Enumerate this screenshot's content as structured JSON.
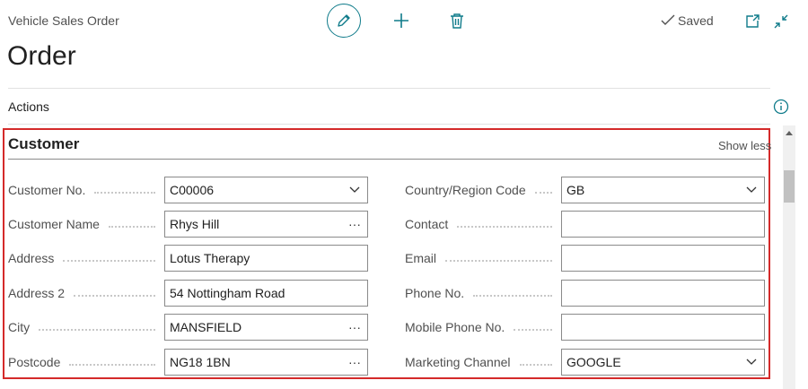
{
  "header": {
    "page_type": "Vehicle Sales Order",
    "title": "Order",
    "saved_label": "Saved"
  },
  "actions_label": "Actions",
  "section": {
    "title": "Customer",
    "show_less": "Show less"
  },
  "left_fields": [
    {
      "label": "Customer No.",
      "value": "C00006",
      "control": "dropdown"
    },
    {
      "label": "Customer Name",
      "value": "Rhys Hill",
      "control": "lookup"
    },
    {
      "label": "Address",
      "value": "Lotus Therapy",
      "control": "text"
    },
    {
      "label": "Address 2",
      "value": "54 Nottingham Road",
      "control": "text"
    },
    {
      "label": "City",
      "value": "MANSFIELD",
      "control": "lookup"
    },
    {
      "label": "Postcode",
      "value": "NG18 1BN",
      "control": "lookup"
    }
  ],
  "right_fields": [
    {
      "label": "Country/Region Code",
      "value": "GB",
      "control": "dropdown"
    },
    {
      "label": "Contact",
      "value": "",
      "control": "text"
    },
    {
      "label": "Email",
      "value": "",
      "control": "text"
    },
    {
      "label": "Phone No.",
      "value": "",
      "control": "text"
    },
    {
      "label": "Mobile Phone No.",
      "value": "",
      "control": "text"
    },
    {
      "label": "Marketing Channel",
      "value": "GOOGLE",
      "control": "dropdown"
    }
  ],
  "lookup_glyph": "···",
  "colors": {
    "accent": "#0f7b8a",
    "highlight_frame": "#d42a2a"
  }
}
